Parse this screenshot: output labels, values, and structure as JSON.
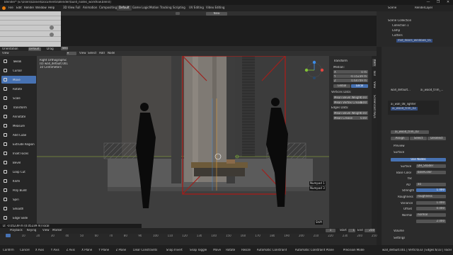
{
  "window": {
    "title": "Blender* [E:\\Users\\Daniel\\Documents\\Blender\\build_nodes_workflow.blend]",
    "controls": [
      "—",
      "❐",
      "✕"
    ]
  },
  "top_menu": [
    "File",
    "Edit",
    "Render",
    "Window",
    "Help"
  ],
  "workspaces": [
    "3D View Full",
    "Animation",
    "Compositing",
    "Default",
    "Game Logic",
    "Motion Tracking",
    "Scripting",
    "UV Editing",
    "Video Editing"
  ],
  "active_workspace": "Default",
  "scene": {
    "name": "Scene",
    "view_layer": "RenderLayer"
  },
  "viewport_header": {
    "mode": "Object Mode",
    "menus": [
      "View",
      "Select",
      "Add",
      "Node"
    ],
    "orientation_label": "Orientation",
    "orientation_value": "Default",
    "drag_label": "Drag",
    "drag_value": "Tweak",
    "new_button": "New",
    "view_label": "View"
  },
  "viewport_info": {
    "line1": "Right Orthographic",
    "line2": "(0) wall_default.001",
    "line3": "10 Centimeters"
  },
  "tools": [
    {
      "label": "Tweak",
      "icon": "tweak-icon"
    },
    {
      "label": "Cursor",
      "icon": "cursor-icon"
    },
    {
      "label": "Move",
      "icon": "move-icon",
      "active": true
    },
    {
      "label": "Rotate",
      "icon": "rotate-icon"
    },
    {
      "label": "Scale",
      "icon": "scale-icon"
    },
    {
      "label": "Transform",
      "icon": "transform-icon"
    },
    {
      "label": "Annotate",
      "icon": "annotate-icon"
    },
    {
      "label": "Measure",
      "icon": "measure-icon"
    },
    {
      "label": "Add Cube",
      "icon": "add-cube-icon"
    },
    {
      "label": "Extrude Region",
      "icon": "extrude-icon"
    },
    {
      "label": "Inset Faces",
      "icon": "inset-icon"
    },
    {
      "label": "Bevel",
      "icon": "bevel-icon"
    },
    {
      "label": "Loop Cut",
      "icon": "loop-cut-icon"
    },
    {
      "label": "Knife",
      "icon": "knife-icon"
    },
    {
      "label": "Poly Build",
      "icon": "poly-build-icon"
    },
    {
      "label": "Spin",
      "icon": "spin-icon"
    },
    {
      "label": "Smooth",
      "icon": "smooth-icon"
    },
    {
      "label": "Edge Slide",
      "icon": "edge-slide-icon"
    }
  ],
  "transform_panel": {
    "title": "Transform",
    "median_label": "Median:",
    "x": {
      "label": "X",
      "value": "0 m"
    },
    "y": {
      "label": "Y",
      "value": "-0.15239 m"
    },
    "z": {
      "label": "Z",
      "value": "0.64709 m"
    },
    "global": "Global",
    "local": "Local",
    "vertices_data": "Vertices Data:",
    "mean_bevel_weight": {
      "label": "Mean Bevel Weight",
      "value": "0.00"
    },
    "mean_crease_v": {
      "label": "Mean Vertex Crease",
      "value": "0.00"
    },
    "edges_data": "Edges Data:",
    "mean_bevel_weight_e": {
      "label": "Mean Bevel Weight",
      "value": "0.00"
    },
    "mean_crease_e": {
      "label": "Mean Crease",
      "value": "0.00"
    }
  },
  "ntabs": [
    "Item",
    "Tool",
    "View",
    "Screencast Keys"
  ],
  "outliner": {
    "items": [
      "Scene Collection",
      "Collection 1",
      "Lamp",
      "Cutters",
      "mid_doors_windows_01"
    ]
  },
  "properties": {
    "object_name": "wall_default...",
    "material_slot": "ai_wood_trim_...",
    "slots": [
      "ai_wall_08_lighter",
      "ai_wood_trim_03"
    ],
    "material_name": "ai_wood_trim_03",
    "assign": "Assign",
    "select": "Select",
    "deselect": "Deselect",
    "preview": "Preview",
    "surface_header": "Surface",
    "use_nodes": "Use Nodes",
    "surface_label": "Surface",
    "surface_value": "DH_Shader",
    "base_color_label": "Base Color",
    "base_color_value": "baseColor",
    "fac_label": "fac",
    "ao_label": "AO",
    "ao_value": "ao",
    "strength_label": "Strength",
    "strength_value": "1.000",
    "roughness_label": "Roughness",
    "roughness_value": "roughness",
    "variance_label": "Variance",
    "variance_value": "1.000",
    "offset_label": "Offset",
    "offset_value": "0.000",
    "normal_label": "Normal",
    "normal_value": "normal",
    "strength2_value": "2.000",
    "volume": "Volume",
    "settings": "Settings"
  },
  "numpad_overlay": [
    "Numpad 1",
    "Numpad 3"
  ],
  "shift_overlay": "Shift",
  "status_readout": "D: -0.05239 m (0.05239 m) local",
  "timeline": {
    "menus": [
      "Playback",
      "Keying",
      "View",
      "Marker"
    ],
    "current": "1",
    "start_label": "Start",
    "start": "1",
    "end_label": "End",
    "end": "250",
    "ticks": [
      "0",
      "10",
      "20",
      "30",
      "40",
      "50",
      "60",
      "70",
      "80",
      "90",
      "100",
      "110",
      "120",
      "130",
      "140",
      "150",
      "160",
      "170",
      "180",
      "190",
      "200",
      "210",
      "220",
      "230",
      "240",
      "250"
    ]
  },
  "statusbar": {
    "items": [
      "Confirm",
      "Cancel",
      "X Axis",
      "Y Axis",
      "Z Axis",
      "X Plane",
      "Y Plane",
      "Z Plane",
      "Clear Constraints",
      "Snap Invert",
      "Snap Toggle",
      "Move",
      "Rotate",
      "Resize",
      "Automatic Constraint",
      "Automatic Constraint Plane",
      "Precision Mode"
    ],
    "stats": "wall_default.001 | Verts:6/33 | Edges:6/33 | Faces:2/11 | Tris:46 | Objects:1/5 | 2.90.0"
  },
  "colors": {
    "accent": "#4772b3",
    "frame_red": "#a0201c",
    "ground_line": "#9abb3a",
    "axis_x": "#e4453f",
    "axis_y": "#82c236",
    "axis_z": "#3b8ce8"
  }
}
